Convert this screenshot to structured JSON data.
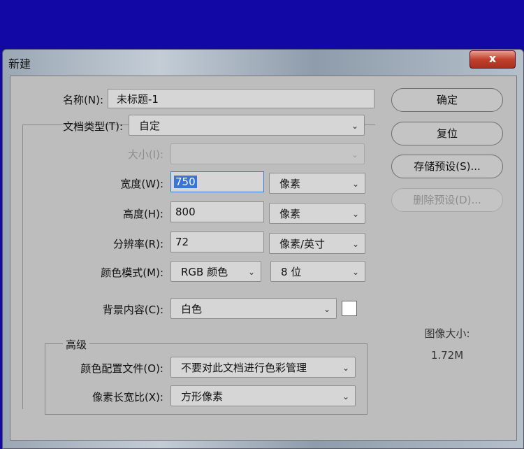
{
  "window": {
    "title": "新建",
    "close": "x"
  },
  "name": {
    "label": "名称(N):",
    "value": "未标题-1"
  },
  "doc_type": {
    "label": "文档类型(T):",
    "value": "自定"
  },
  "size": {
    "label": "大小(I):",
    "value": ""
  },
  "width": {
    "label": "宽度(W):",
    "value": "750",
    "unit": "像素"
  },
  "height": {
    "label": "高度(H):",
    "value": "800",
    "unit": "像素"
  },
  "resolution": {
    "label": "分辨率(R):",
    "value": "72",
    "unit": "像素/英寸"
  },
  "color_mode": {
    "label": "颜色模式(M):",
    "value": "RGB 颜色",
    "depth": "8 位"
  },
  "background": {
    "label": "背景内容(C):",
    "value": "白色",
    "swatch": "#ffffff"
  },
  "advanced": {
    "title": "高级",
    "profile_label": "颜色配置文件(O):",
    "profile_value": "不要对此文档进行色彩管理",
    "aspect_label": "像素长宽比(X):",
    "aspect_value": "方形像素"
  },
  "buttons": {
    "ok": "确定",
    "reset": "复位",
    "save_preset": "存储预设(S)...",
    "delete_preset": "删除预设(D)..."
  },
  "image_size": {
    "label": "图像大小:",
    "value": "1.72M"
  },
  "chev": "⌄"
}
